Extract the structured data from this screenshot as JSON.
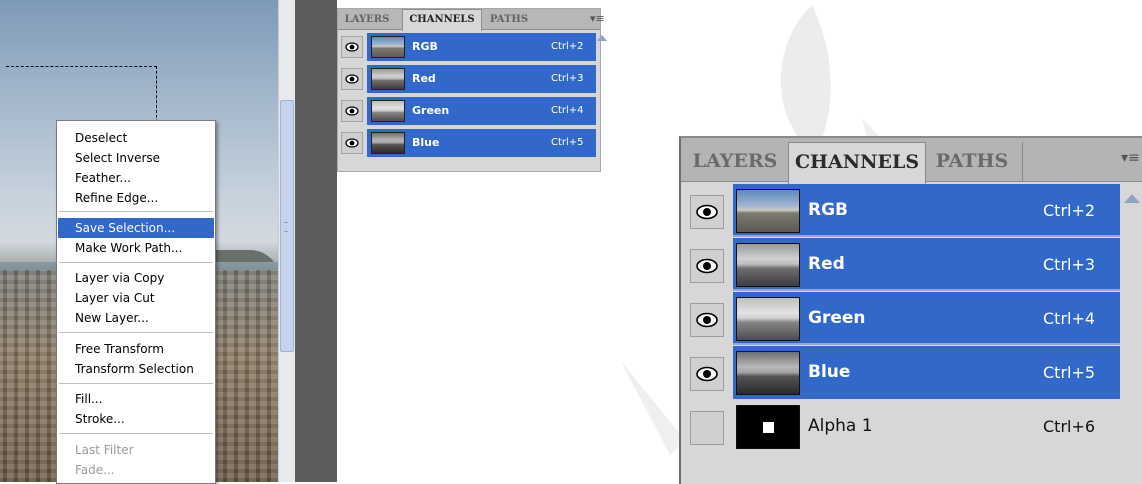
{
  "context_menu": {
    "items": [
      {
        "label": "Deselect",
        "state": "normal"
      },
      {
        "label": "Select Inverse",
        "state": "normal"
      },
      {
        "label": "Feather...",
        "state": "normal"
      },
      {
        "label": "Refine Edge...",
        "state": "normal"
      },
      {
        "label": "Save Selection...",
        "state": "highlighted"
      },
      {
        "label": "Make Work Path...",
        "state": "normal"
      },
      {
        "label": "Layer via Copy",
        "state": "normal"
      },
      {
        "label": "Layer via Cut",
        "state": "normal"
      },
      {
        "label": "New Layer...",
        "state": "normal"
      },
      {
        "label": "Free Transform",
        "state": "normal"
      },
      {
        "label": "Transform Selection",
        "state": "normal"
      },
      {
        "label": "Fill...",
        "state": "normal"
      },
      {
        "label": "Stroke...",
        "state": "normal"
      },
      {
        "label": "Last Filter",
        "state": "disabled"
      },
      {
        "label": "Fade...",
        "state": "disabled"
      }
    ]
  },
  "small_panel": {
    "tabs": [
      "LAYERS",
      "CHANNELS",
      "PATHS"
    ],
    "active_tab": "CHANNELS",
    "channels": [
      {
        "name": "RGB",
        "shortcut": "Ctrl+2"
      },
      {
        "name": "Red",
        "shortcut": "Ctrl+3"
      },
      {
        "name": "Green",
        "shortcut": "Ctrl+4"
      },
      {
        "name": "Blue",
        "shortcut": "Ctrl+5"
      }
    ]
  },
  "large_panel": {
    "tabs": [
      "LAYERS",
      "CHANNELS",
      "PATHS"
    ],
    "active_tab": "CHANNELS",
    "channels": [
      {
        "name": "RGB",
        "shortcut": "Ctrl+2",
        "selected": true,
        "visible": true
      },
      {
        "name": "Red",
        "shortcut": "Ctrl+3",
        "selected": true,
        "visible": true
      },
      {
        "name": "Green",
        "shortcut": "Ctrl+4",
        "selected": true,
        "visible": true
      },
      {
        "name": "Blue",
        "shortcut": "Ctrl+5",
        "selected": true,
        "visible": true
      },
      {
        "name": "Alpha 1",
        "shortcut": "Ctrl+6",
        "selected": false,
        "visible": false
      }
    ]
  },
  "colors": {
    "selection_blue": "#3168c9",
    "panel_gray": "#d7d7d7"
  },
  "icons": {
    "eye": "eye-icon",
    "panel_menu": "panel-menu-icon",
    "scroll_up": "scroll-up-arrow-icon"
  }
}
